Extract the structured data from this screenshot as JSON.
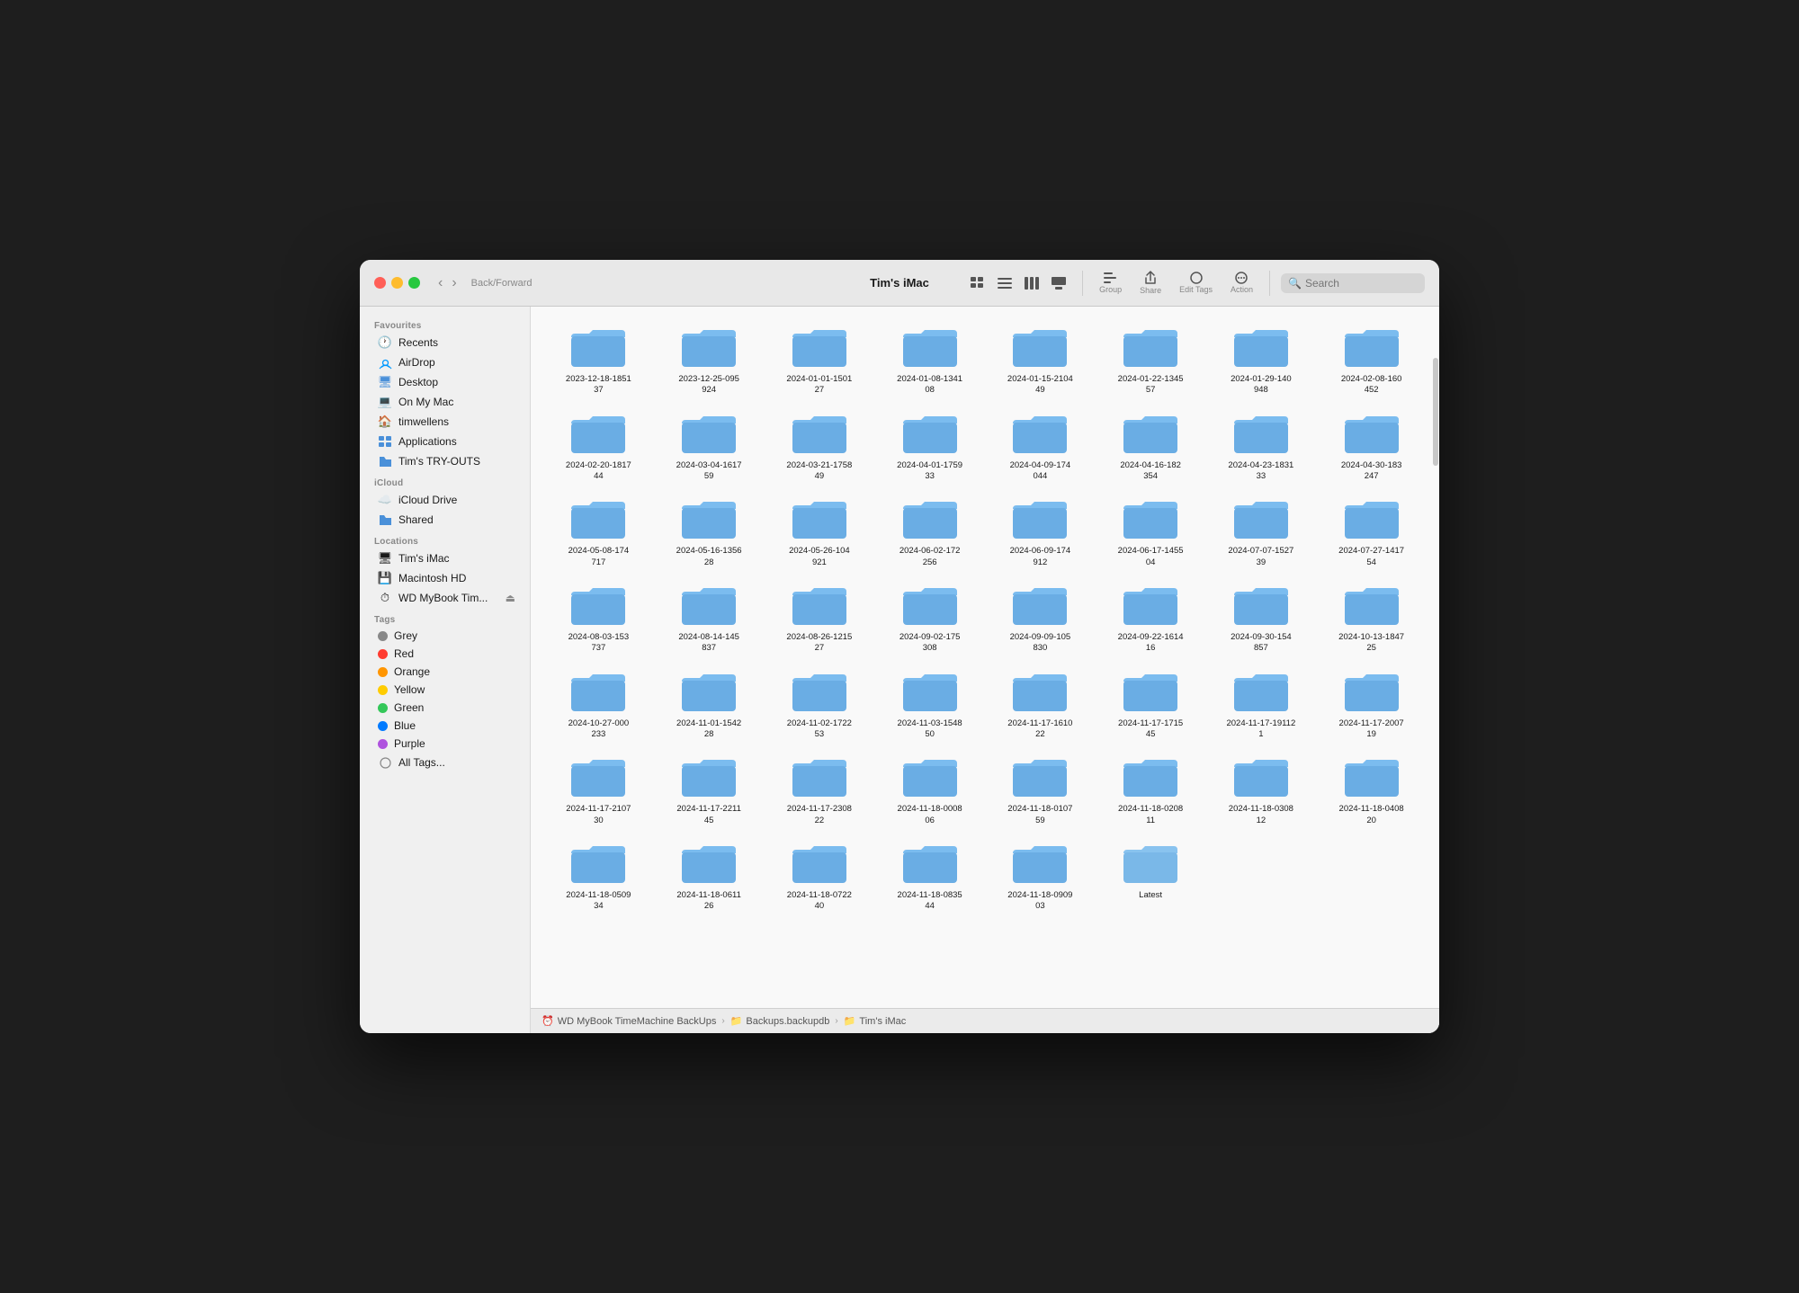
{
  "window": {
    "title": "Tim's iMac"
  },
  "toolbar": {
    "back_label": "Back/Forward",
    "title": "Tim's iMac",
    "view_label": "View",
    "group_label": "Group",
    "share_label": "Share",
    "edit_tags_label": "Edit Tags",
    "action_label": "Action",
    "search_placeholder": "Search",
    "search_label": "Search"
  },
  "sidebar": {
    "favourites_label": "Favourites",
    "icloud_label": "iCloud",
    "locations_label": "Locations",
    "tags_label": "Tags",
    "items": {
      "favourites": [
        {
          "id": "recents",
          "label": "Recents",
          "icon": "🕐",
          "color": "#0099ff"
        },
        {
          "id": "airdrop",
          "label": "AirDrop",
          "icon": "📡",
          "color": "#0099ff"
        },
        {
          "id": "desktop",
          "label": "Desktop",
          "icon": "🖥",
          "color": "#4a90d9"
        },
        {
          "id": "on-my-mac",
          "label": "On My Mac",
          "icon": "💻",
          "color": "#4a90d9"
        },
        {
          "id": "timwellens",
          "label": "timwellens",
          "icon": "🏠",
          "color": "#4a90d9"
        },
        {
          "id": "applications",
          "label": "Applications",
          "icon": "📁",
          "color": "#4a90d9"
        },
        {
          "id": "tims-tryouts",
          "label": "Tim's TRY-OUTS",
          "icon": "📁",
          "color": "#4a90d9"
        }
      ],
      "icloud": [
        {
          "id": "icloud-drive",
          "label": "iCloud Drive",
          "icon": "☁",
          "color": "#4a90d9"
        },
        {
          "id": "shared",
          "label": "Shared",
          "icon": "📁",
          "color": "#4a90d9"
        }
      ],
      "locations": [
        {
          "id": "tims-imac",
          "label": "Tim's iMac",
          "icon": "🖥",
          "color": "#555"
        },
        {
          "id": "macintosh-hd",
          "label": "Macintosh HD",
          "icon": "💾",
          "color": "#555"
        },
        {
          "id": "wd-mybook",
          "label": "WD MyBook Tim...",
          "icon": "⏰",
          "color": "#555",
          "eject": true
        }
      ],
      "tags": [
        {
          "id": "grey",
          "label": "Grey",
          "color": "#888888"
        },
        {
          "id": "red",
          "label": "Red",
          "color": "#ff3b30"
        },
        {
          "id": "orange",
          "label": "Orange",
          "color": "#ff9500"
        },
        {
          "id": "yellow",
          "label": "Yellow",
          "color": "#ffcc00"
        },
        {
          "id": "green",
          "label": "Green",
          "color": "#34c759"
        },
        {
          "id": "blue",
          "label": "Blue",
          "color": "#007aff"
        },
        {
          "id": "purple",
          "label": "Purple",
          "color": "#af52de"
        },
        {
          "id": "all-tags",
          "label": "All Tags...",
          "color": null
        }
      ]
    }
  },
  "folders": [
    {
      "name": "2023-12-18-1851\n37"
    },
    {
      "name": "2023-12-25-095\n924"
    },
    {
      "name": "2024-01-01-1501\n27"
    },
    {
      "name": "2024-01-08-1341\n08"
    },
    {
      "name": "2024-01-15-2104\n49"
    },
    {
      "name": "2024-01-22-1345\n57"
    },
    {
      "name": "2024-01-29-140\n948"
    },
    {
      "name": "2024-02-08-160\n452"
    },
    {
      "name": "2024-02-20-1817\n44"
    },
    {
      "name": "2024-03-04-1617\n59"
    },
    {
      "name": "2024-03-21-1758\n49"
    },
    {
      "name": "2024-04-01-1759\n33"
    },
    {
      "name": "2024-04-09-174\n044"
    },
    {
      "name": "2024-04-16-182\n354"
    },
    {
      "name": "2024-04-23-1831\n33"
    },
    {
      "name": "2024-04-30-183\n247"
    },
    {
      "name": "2024-05-08-174\n717"
    },
    {
      "name": "2024-05-16-1356\n28"
    },
    {
      "name": "2024-05-26-104\n921"
    },
    {
      "name": "2024-06-02-172\n256"
    },
    {
      "name": "2024-06-09-174\n912"
    },
    {
      "name": "2024-06-17-1455\n04"
    },
    {
      "name": "2024-07-07-1527\n39"
    },
    {
      "name": "2024-07-27-1417\n54"
    },
    {
      "name": "2024-08-03-153\n737"
    },
    {
      "name": "2024-08-14-145\n837"
    },
    {
      "name": "2024-08-26-1215\n27"
    },
    {
      "name": "2024-09-02-175\n308"
    },
    {
      "name": "2024-09-09-105\n830"
    },
    {
      "name": "2024-09-22-1614\n16"
    },
    {
      "name": "2024-09-30-154\n857"
    },
    {
      "name": "2024-10-13-1847\n25"
    },
    {
      "name": "2024-10-27-000\n233"
    },
    {
      "name": "2024-11-01-1542\n28"
    },
    {
      "name": "2024-11-02-1722\n53"
    },
    {
      "name": "2024-11-03-1548\n50"
    },
    {
      "name": "2024-11-17-1610\n22"
    },
    {
      "name": "2024-11-17-1715\n45"
    },
    {
      "name": "2024-11-17-19112\n1"
    },
    {
      "name": "2024-11-17-2007\n19"
    },
    {
      "name": "2024-11-17-2107\n30"
    },
    {
      "name": "2024-11-17-2211\n45"
    },
    {
      "name": "2024-11-17-2308\n22"
    },
    {
      "name": "2024-11-18-0008\n06"
    },
    {
      "name": "2024-11-18-0107\n59"
    },
    {
      "name": "2024-11-18-0208\n11"
    },
    {
      "name": "2024-11-18-0308\n12"
    },
    {
      "name": "2024-11-18-0408\n20"
    },
    {
      "name": "2024-11-18-0509\n34"
    },
    {
      "name": "2024-11-18-0611\n26"
    },
    {
      "name": "2024-11-18-0722\n40"
    },
    {
      "name": "2024-11-18-0835\n44"
    },
    {
      "name": "2024-11-18-0909\n03"
    },
    {
      "name": "Latest",
      "is_latest": true
    }
  ],
  "breadcrumb": [
    {
      "label": "WD MyBook TimeMachine BackUps",
      "icon": "⏰"
    },
    {
      "label": "Backups.backupdb",
      "icon": "📁"
    },
    {
      "label": "Tim's iMac",
      "icon": "📁"
    }
  ]
}
